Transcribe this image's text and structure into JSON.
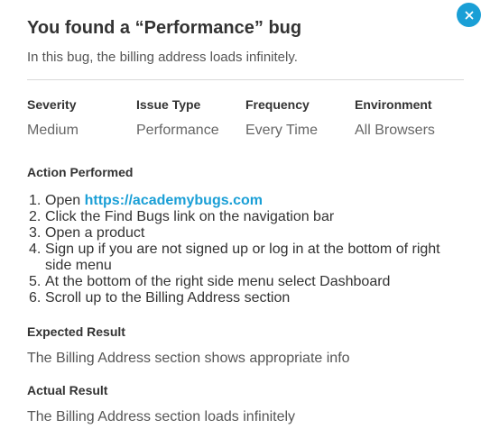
{
  "dialog": {
    "title": "You found a “Performance” bug",
    "subtitle": "In this bug, the billing address loads infinitely.",
    "close_icon": "close-icon",
    "accent_color": "#1a9fd6"
  },
  "meta": {
    "severity_label": "Severity",
    "severity_value": "Medium",
    "issue_type_label": "Issue Type",
    "issue_type_value": "Performance",
    "frequency_label": "Frequency",
    "frequency_value": "Every Time",
    "environment_label": "Environment",
    "environment_value": "All Browsers"
  },
  "action": {
    "heading": "Action Performed",
    "steps": [
      {
        "num": "1.",
        "prefix": "Open ",
        "link": "https://academybugs.com"
      },
      {
        "num": "2.",
        "text": "Click the Find Bugs link on the navigation bar"
      },
      {
        "num": "3.",
        "text": "Open a product"
      },
      {
        "num": "4.",
        "text": "Sign up if you are not signed up or log in at the bottom of right side menu"
      },
      {
        "num": "5.",
        "text": "At the bottom of the right side menu select Dashboard"
      },
      {
        "num": "6.",
        "text": "Scroll up to the Billing Address section"
      }
    ]
  },
  "expected": {
    "heading": "Expected Result",
    "text": "The Billing Address section shows appropriate info"
  },
  "actual": {
    "heading": "Actual Result",
    "text": "The Billing Address section loads infinitely"
  }
}
